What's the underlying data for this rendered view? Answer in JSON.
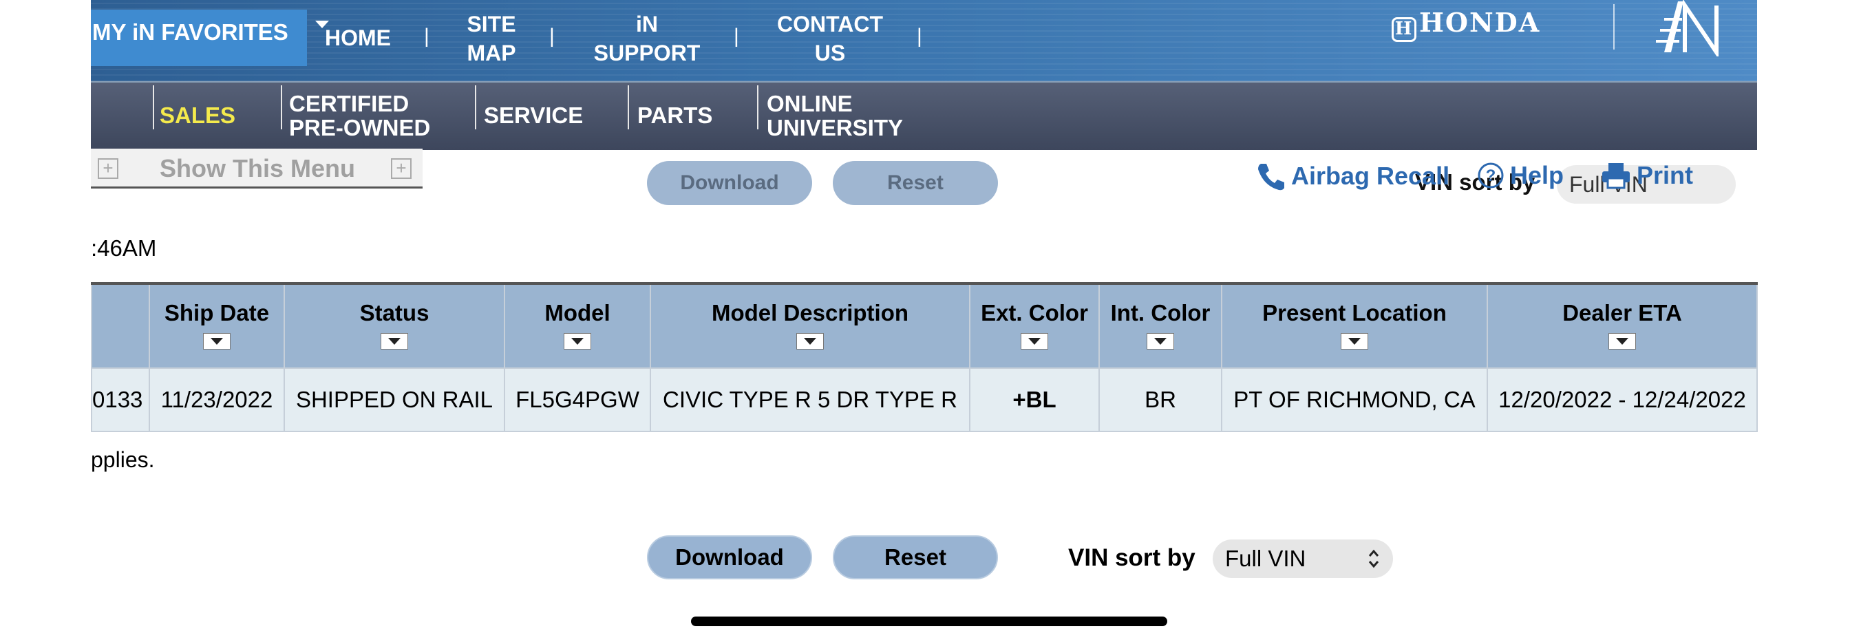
{
  "ghost_row": {
    "download_label": "Download",
    "reset_label": "Reset",
    "vin_sort_label": "VIN sort by",
    "vin_sort_value": "Full VIN"
  },
  "topnav": {
    "favorites_label": "MY iN FAVORITES",
    "items": [
      {
        "label": "HOME"
      },
      {
        "label": "SITE\nMAP"
      },
      {
        "label": "iN\nSUPPORT"
      },
      {
        "label": "CONTACT\nUS"
      }
    ],
    "brand": "HONDA"
  },
  "subnav": {
    "items": [
      {
        "label": "SALES",
        "active": true
      },
      {
        "label": "CERTIFIED\nPRE-OWNED"
      },
      {
        "label": "SERVICE"
      },
      {
        "label": "PARTS"
      },
      {
        "label": "ONLINE\nUNIVERSITY"
      }
    ]
  },
  "show_menu": {
    "label": "Show This Menu"
  },
  "utility": {
    "airbag_label": "Airbag Recall",
    "help_label": "Help",
    "print_label": "Print"
  },
  "timestamp_text": ":46AM",
  "table": {
    "columns": [
      "",
      "Ship Date",
      "Status",
      "Model",
      "Model Description",
      "Ext. Color",
      "Int. Color",
      "Present Location",
      "Dealer ETA"
    ],
    "rows": [
      [
        "0133",
        "11/23/2022",
        "SHIPPED ON RAIL",
        "FL5G4PGW",
        "CIVIC TYPE R 5 DR TYPE R",
        "+BL",
        "BR",
        "PT OF RICHMOND, CA",
        "12/20/2022 - 12/24/2022"
      ]
    ]
  },
  "footnote": "pplies.",
  "controls": {
    "download_label": "Download",
    "reset_label": "Reset",
    "vin_sort_label": "VIN sort by",
    "vin_sort_value": "Full VIN"
  },
  "colors": {
    "nav_blue": "#3a74ad",
    "subnav_slate": "#3d465c",
    "active_yellow": "#f4ea4c",
    "header_blue": "#9ab4d0",
    "cell_bg": "#e4edf2",
    "link_blue": "#2d69b0"
  }
}
